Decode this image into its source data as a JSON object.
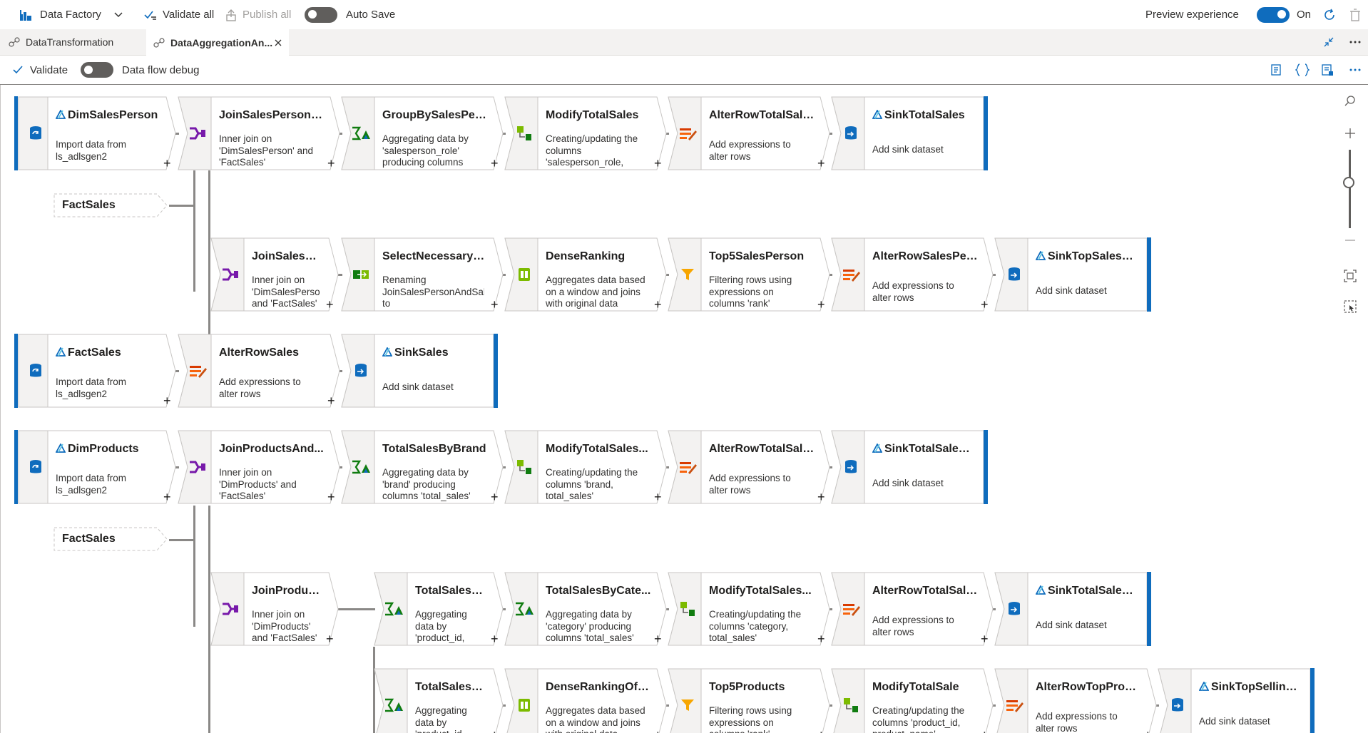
{
  "topbar": {
    "product": "Data Factory",
    "validate_all": "Validate all",
    "publish_all": "Publish all",
    "auto_save": "Auto Save",
    "preview_experience": "Preview experience",
    "preview_state": "On"
  },
  "tabs": [
    {
      "label": "DataTransformation",
      "active": false
    },
    {
      "label": "DataAggregationAn...",
      "active": true
    }
  ],
  "toolbar": {
    "validate": "Validate",
    "debug": "Data flow debug"
  },
  "nodes": [
    {
      "title": "DimSalesPerson",
      "desc": "Import data from ls_adlsgen2",
      "kind": "source"
    },
    {
      "title": "JoinSalesPersonA...",
      "desc": "Inner join on 'DimSalesPerson' and 'FactSales'",
      "kind": "join"
    },
    {
      "title": "GroupBySalesPers...",
      "desc": "Aggregating data by 'salesperson_role' producing columns 'total_sales'",
      "kind": "aggregate"
    },
    {
      "title": "ModifyTotalSales",
      "desc": "Creating/updating the columns 'salesperson_role, total_sales'",
      "kind": "derive"
    },
    {
      "title": "AlterRowTotalSales",
      "desc": "Add expressions to alter rows",
      "kind": "alter"
    },
    {
      "title": "SinkTotalSales",
      "desc": "Add sink dataset",
      "kind": "sink"
    },
    {
      "title": "JoinSalesPersonA...",
      "desc": "Inner join on 'DimSalesPerson' and 'FactSales'",
      "kind": "join"
    },
    {
      "title": "SelectNecessaryC...",
      "desc": "Renaming JoinSalesPersonAndSales to SelectNecessaryColumns",
      "kind": "select"
    },
    {
      "title": "DenseRanking",
      "desc": "Aggregates data based on a window and joins with original data",
      "kind": "window"
    },
    {
      "title": "Top5SalesPerson",
      "desc": "Filtering rows using expressions on columns 'rank'",
      "kind": "filter"
    },
    {
      "title": "AlterRowSalesPer...",
      "desc": "Add expressions to alter rows",
      "kind": "alter"
    },
    {
      "title": "SinkTopSalesPe...",
      "desc": "Add sink dataset",
      "kind": "sink"
    },
    {
      "title": "FactSales",
      "desc": "Import data from ls_adlsgen2",
      "kind": "source"
    },
    {
      "title": "AlterRowSales",
      "desc": "Add expressions to alter rows",
      "kind": "alter"
    },
    {
      "title": "SinkSales",
      "desc": "Add sink dataset",
      "kind": "sink"
    },
    {
      "title": "DimProducts",
      "desc": "Import data from ls_adlsgen2",
      "kind": "source"
    },
    {
      "title": "JoinProductsAnd...",
      "desc": "Inner join on 'DimProducts' and 'FactSales'",
      "kind": "join"
    },
    {
      "title": "TotalSalesByBrand",
      "desc": "Aggregating data by 'brand' producing columns 'total_sales'",
      "kind": "aggregate"
    },
    {
      "title": "ModifyTotalSales...",
      "desc": "Creating/updating the columns 'brand, total_sales'",
      "kind": "derive"
    },
    {
      "title": "AlterRowTotalSale...",
      "desc": "Add expressions to alter rows",
      "kind": "alter"
    },
    {
      "title": "SinkTotalSalesB...",
      "desc": "Add sink dataset",
      "kind": "sink"
    },
    {
      "title": "JoinProductsAnd...",
      "desc": "Inner join on 'DimProducts' and 'FactSales'",
      "kind": "join"
    },
    {
      "title": "TotalSalesByProd...",
      "desc": "Aggregating data by 'product_id, product_name, category'",
      "kind": "aggregate"
    },
    {
      "title": "TotalSalesByCate...",
      "desc": "Aggregating data by 'category' producing columns 'total_sales'",
      "kind": "aggregate"
    },
    {
      "title": "ModifyTotalSales...",
      "desc": "Creating/updating the columns 'category, total_sales'",
      "kind": "derive"
    },
    {
      "title": "AlterRowTotalSale...",
      "desc": "Add expressions to alter rows",
      "kind": "alter"
    },
    {
      "title": "SinkTotalSalesB...",
      "desc": "Add sink dataset",
      "kind": "sink"
    },
    {
      "title": "TotalSalesByProd...",
      "desc": "Aggregating data by 'product_id, product_name'",
      "kind": "aggregate"
    },
    {
      "title": "DenseRankingOfP...",
      "desc": "Aggregates data based on a window and joins with original data",
      "kind": "window"
    },
    {
      "title": "Top5Products",
      "desc": "Filtering rows using expressions on columns 'rank'",
      "kind": "filter"
    },
    {
      "title": "ModifyTotalSale",
      "desc": "Creating/updating the columns 'product_id, product_name'",
      "kind": "derive"
    },
    {
      "title": "AlterRowTopProd...",
      "desc": "Add expressions to alter rows",
      "kind": "alter"
    },
    {
      "title": "SinkTopSellingP...",
      "desc": "Add sink dataset",
      "kind": "sink"
    }
  ],
  "refs": [
    {
      "label": "FactSales"
    },
    {
      "label": "FactSales"
    }
  ],
  "colors": {
    "accent": "#0f6cbd",
    "sink_bar": "#0f6cbd",
    "connector": "#8a8886"
  }
}
